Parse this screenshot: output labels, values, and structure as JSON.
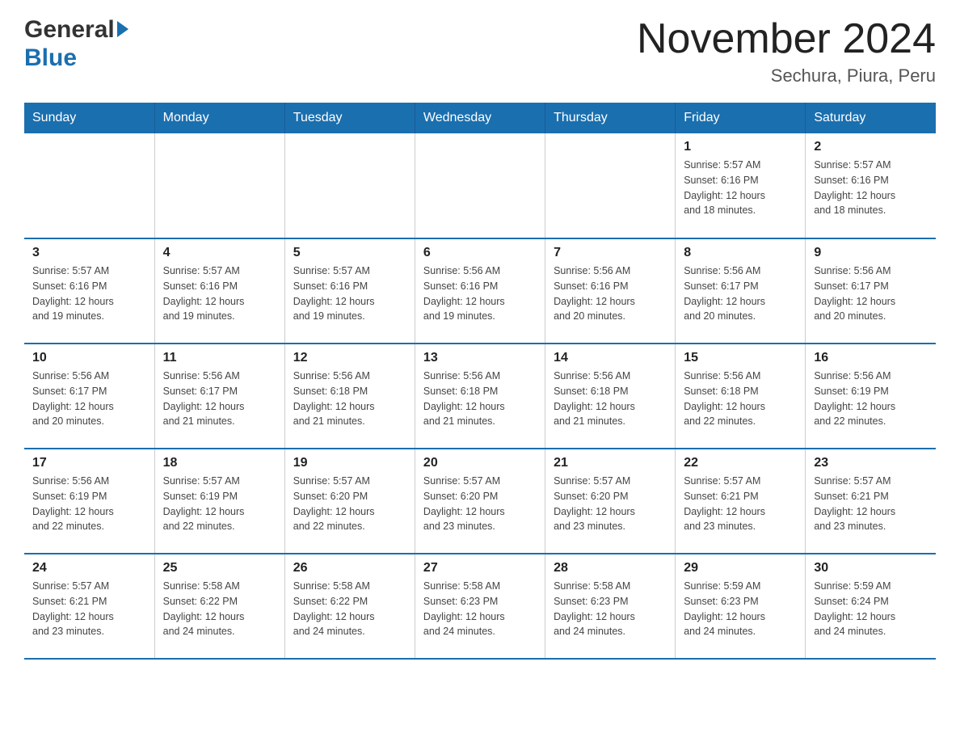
{
  "logo": {
    "general": "General",
    "blue": "Blue"
  },
  "title": "November 2024",
  "subtitle": "Sechura, Piura, Peru",
  "weekdays": [
    "Sunday",
    "Monday",
    "Tuesday",
    "Wednesday",
    "Thursday",
    "Friday",
    "Saturday"
  ],
  "weeks": [
    [
      {
        "day": "",
        "info": ""
      },
      {
        "day": "",
        "info": ""
      },
      {
        "day": "",
        "info": ""
      },
      {
        "day": "",
        "info": ""
      },
      {
        "day": "",
        "info": ""
      },
      {
        "day": "1",
        "info": "Sunrise: 5:57 AM\nSunset: 6:16 PM\nDaylight: 12 hours\nand 18 minutes."
      },
      {
        "day": "2",
        "info": "Sunrise: 5:57 AM\nSunset: 6:16 PM\nDaylight: 12 hours\nand 18 minutes."
      }
    ],
    [
      {
        "day": "3",
        "info": "Sunrise: 5:57 AM\nSunset: 6:16 PM\nDaylight: 12 hours\nand 19 minutes."
      },
      {
        "day": "4",
        "info": "Sunrise: 5:57 AM\nSunset: 6:16 PM\nDaylight: 12 hours\nand 19 minutes."
      },
      {
        "day": "5",
        "info": "Sunrise: 5:57 AM\nSunset: 6:16 PM\nDaylight: 12 hours\nand 19 minutes."
      },
      {
        "day": "6",
        "info": "Sunrise: 5:56 AM\nSunset: 6:16 PM\nDaylight: 12 hours\nand 19 minutes."
      },
      {
        "day": "7",
        "info": "Sunrise: 5:56 AM\nSunset: 6:16 PM\nDaylight: 12 hours\nand 20 minutes."
      },
      {
        "day": "8",
        "info": "Sunrise: 5:56 AM\nSunset: 6:17 PM\nDaylight: 12 hours\nand 20 minutes."
      },
      {
        "day": "9",
        "info": "Sunrise: 5:56 AM\nSunset: 6:17 PM\nDaylight: 12 hours\nand 20 minutes."
      }
    ],
    [
      {
        "day": "10",
        "info": "Sunrise: 5:56 AM\nSunset: 6:17 PM\nDaylight: 12 hours\nand 20 minutes."
      },
      {
        "day": "11",
        "info": "Sunrise: 5:56 AM\nSunset: 6:17 PM\nDaylight: 12 hours\nand 21 minutes."
      },
      {
        "day": "12",
        "info": "Sunrise: 5:56 AM\nSunset: 6:18 PM\nDaylight: 12 hours\nand 21 minutes."
      },
      {
        "day": "13",
        "info": "Sunrise: 5:56 AM\nSunset: 6:18 PM\nDaylight: 12 hours\nand 21 minutes."
      },
      {
        "day": "14",
        "info": "Sunrise: 5:56 AM\nSunset: 6:18 PM\nDaylight: 12 hours\nand 21 minutes."
      },
      {
        "day": "15",
        "info": "Sunrise: 5:56 AM\nSunset: 6:18 PM\nDaylight: 12 hours\nand 22 minutes."
      },
      {
        "day": "16",
        "info": "Sunrise: 5:56 AM\nSunset: 6:19 PM\nDaylight: 12 hours\nand 22 minutes."
      }
    ],
    [
      {
        "day": "17",
        "info": "Sunrise: 5:56 AM\nSunset: 6:19 PM\nDaylight: 12 hours\nand 22 minutes."
      },
      {
        "day": "18",
        "info": "Sunrise: 5:57 AM\nSunset: 6:19 PM\nDaylight: 12 hours\nand 22 minutes."
      },
      {
        "day": "19",
        "info": "Sunrise: 5:57 AM\nSunset: 6:20 PM\nDaylight: 12 hours\nand 22 minutes."
      },
      {
        "day": "20",
        "info": "Sunrise: 5:57 AM\nSunset: 6:20 PM\nDaylight: 12 hours\nand 23 minutes."
      },
      {
        "day": "21",
        "info": "Sunrise: 5:57 AM\nSunset: 6:20 PM\nDaylight: 12 hours\nand 23 minutes."
      },
      {
        "day": "22",
        "info": "Sunrise: 5:57 AM\nSunset: 6:21 PM\nDaylight: 12 hours\nand 23 minutes."
      },
      {
        "day": "23",
        "info": "Sunrise: 5:57 AM\nSunset: 6:21 PM\nDaylight: 12 hours\nand 23 minutes."
      }
    ],
    [
      {
        "day": "24",
        "info": "Sunrise: 5:57 AM\nSunset: 6:21 PM\nDaylight: 12 hours\nand 23 minutes."
      },
      {
        "day": "25",
        "info": "Sunrise: 5:58 AM\nSunset: 6:22 PM\nDaylight: 12 hours\nand 24 minutes."
      },
      {
        "day": "26",
        "info": "Sunrise: 5:58 AM\nSunset: 6:22 PM\nDaylight: 12 hours\nand 24 minutes."
      },
      {
        "day": "27",
        "info": "Sunrise: 5:58 AM\nSunset: 6:23 PM\nDaylight: 12 hours\nand 24 minutes."
      },
      {
        "day": "28",
        "info": "Sunrise: 5:58 AM\nSunset: 6:23 PM\nDaylight: 12 hours\nand 24 minutes."
      },
      {
        "day": "29",
        "info": "Sunrise: 5:59 AM\nSunset: 6:23 PM\nDaylight: 12 hours\nand 24 minutes."
      },
      {
        "day": "30",
        "info": "Sunrise: 5:59 AM\nSunset: 6:24 PM\nDaylight: 12 hours\nand 24 minutes."
      }
    ]
  ]
}
